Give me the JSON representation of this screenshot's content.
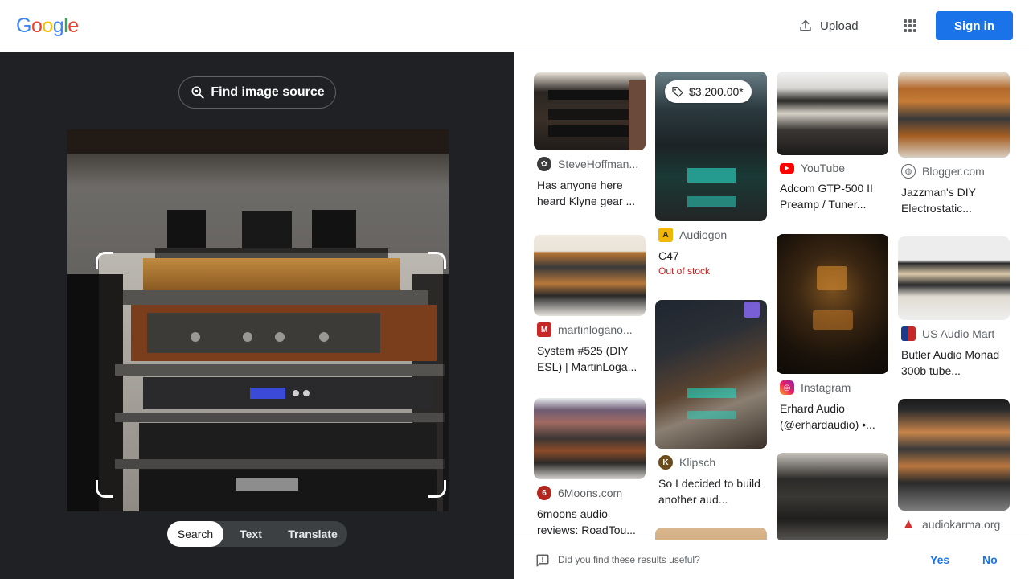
{
  "header": {
    "logo": [
      "G",
      "o",
      "o",
      "g",
      "l",
      "e"
    ],
    "upload_label": "Upload",
    "signin_label": "Sign in"
  },
  "lens": {
    "find_source_label": "Find image source",
    "modes": [
      {
        "label": "Search",
        "active": true
      },
      {
        "label": "Text",
        "active": false
      },
      {
        "label": "Translate",
        "active": false
      }
    ]
  },
  "results": [
    {
      "source": "SteveHoffman...",
      "title": "Has anyone here heard Klyne gear ...",
      "icon": "hoffman-icon"
    },
    {
      "source": "martinlogano...",
      "title": "System #525 (DIY ESL) | MartinLoga...",
      "icon": "martinlogan-icon"
    },
    {
      "source": "6Moons.com",
      "title": "6moons audio reviews: RoadTou...",
      "icon": "6moons-icon"
    },
    {
      "source": "Audiogon",
      "title": "C47",
      "price": "$3,200.00*",
      "stock": "Out of stock",
      "icon": "audiogon-icon"
    },
    {
      "source": "Klipsch",
      "title": "So I decided to build another aud...",
      "icon": "klipsch-icon"
    },
    {
      "source": "YouTube",
      "title": "Adcom GTP-500 II Preamp / Tuner...",
      "icon": "youtube-icon"
    },
    {
      "source": "Instagram",
      "title": "Erhard Audio (@erhardaudio) •...",
      "icon": "instagram-icon"
    },
    {
      "source": "Blogger.com",
      "title": "Jazzman's DIY Electrostatic...",
      "icon": "globe-icon"
    },
    {
      "source": "US Audio Mart",
      "title": "Butler Audio Monad 300b tube...",
      "icon": "usaudiomart-icon"
    },
    {
      "source": "audiokarma.org",
      "title": "",
      "icon": "audiokarma-icon"
    }
  ],
  "feedback": {
    "question": "Did you find these results useful?",
    "yes": "Yes",
    "no": "No"
  },
  "colors": {
    "accent": "#1a73e8",
    "left_panel_bg": "#202124",
    "out_of_stock": "#c5221f"
  }
}
